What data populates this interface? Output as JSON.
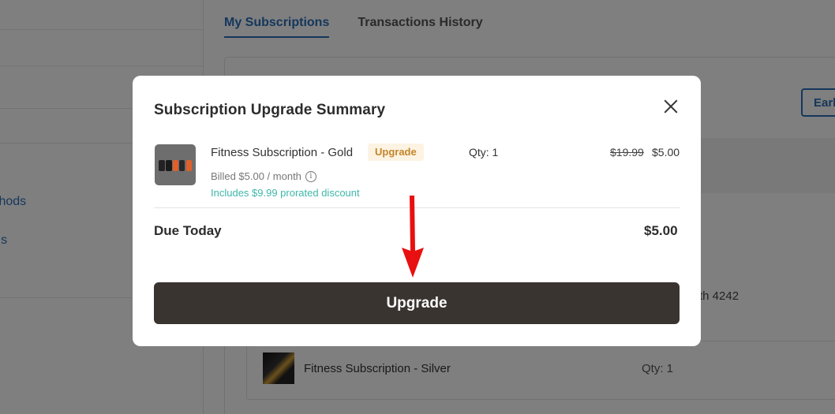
{
  "background": {
    "tabs": [
      {
        "label": "My Subscriptions",
        "active": true
      },
      {
        "label": "Transactions History",
        "active": false
      }
    ],
    "sidebar_links": [
      "thods",
      "ils"
    ],
    "action_button_label": "Earl",
    "card_suffix": "th 4242",
    "item_name": "Fitness Subscription - Silver",
    "item_qty": "Qty: 1"
  },
  "modal": {
    "title": "Subscription Upgrade Summary",
    "item": {
      "name": "Fitness Subscription - Gold",
      "badge": "Upgrade",
      "billed": "Billed $5.00 / month",
      "discount": "Includes $9.99 prorated discount",
      "qty": "Qty: 1",
      "old_price": "$19.99",
      "new_price": "$5.00"
    },
    "due_label": "Due Today",
    "due_amount": "$5.00",
    "upgrade_button": "Upgrade"
  },
  "colors": {
    "accent": "#2b6fb8",
    "badge_bg": "#fcf3e3",
    "badge_text": "#c5852a",
    "discount_text": "#3fb7a9",
    "button_bg": "#3a3431",
    "annotation_arrow": "#e81010"
  },
  "icons": {
    "close": "close-icon",
    "info": "info-icon",
    "annotation": "red-arrow-annotation"
  }
}
